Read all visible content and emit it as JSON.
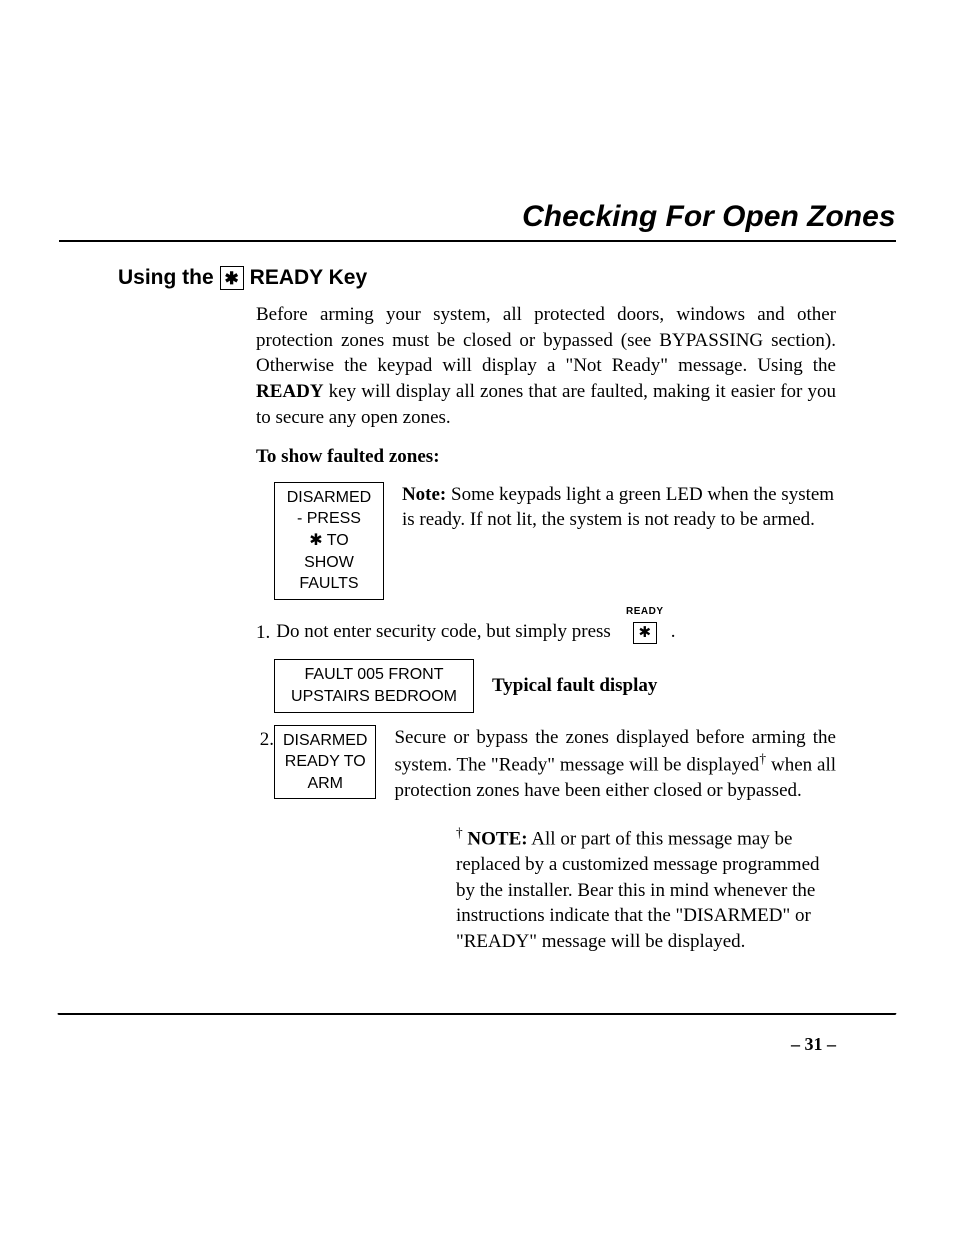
{
  "title": "Checking For Open Zones",
  "section_heading_prefix": "Using the",
  "section_heading_key_glyph": "✱",
  "section_heading_suffix": "READY Key",
  "intro_paragraph_1a": "Before arming your system, all protected doors, windows and other protection zones must be closed or bypassed (see BYPASSING section).  Otherwise the keypad will display a \"Not Ready\" message. Using the ",
  "intro_paragraph_1b_bold": "READY",
  "intro_paragraph_1c": " key will display all zones that are faulted, making it easier for you to secure any open zones.",
  "sub_heading": "To show faulted zones:",
  "lcd_1_line1": "DISARMED - PRESS",
  "lcd_1_line2_glyph": "✱",
  "lcd_1_line2_text": " TO SHOW FAULTS",
  "note_1_label": "Note: ",
  "note_1_text": "Some keypads light a green LED when the system is ready. If not lit, the system is not ready to be armed.",
  "step_1_num": "1.",
  "step_1_text": "Do not enter security code, but simply press",
  "ready_key_label": "READY",
  "ready_key_glyph": "✱",
  "step_1_period": ".",
  "lcd_2_line1": "FAULT  005  FRONT",
  "lcd_2_line2": "UPSTAIRS BEDROOM",
  "typical_label": "Typical fault display",
  "step_2_num": "2.",
  "lcd_3_line1": "DISARMED",
  "lcd_3_line2": "READY TO ARM",
  "step_2_text_a": "Secure or bypass the zones displayed before arming the system. The \"Ready\" message will be displayed",
  "dagger": "†",
  "step_2_text_b": " when all protection zones have been either closed or bypassed.",
  "footnote_label": "NOTE:",
  "footnote_text": " All or part of this message may be replaced by a customized message programmed by the installer.  Bear this in mind whenever the instructions indicate that the \"DISARMED\" or \"READY\" message will be displayed.",
  "page_number": "– 31 –"
}
